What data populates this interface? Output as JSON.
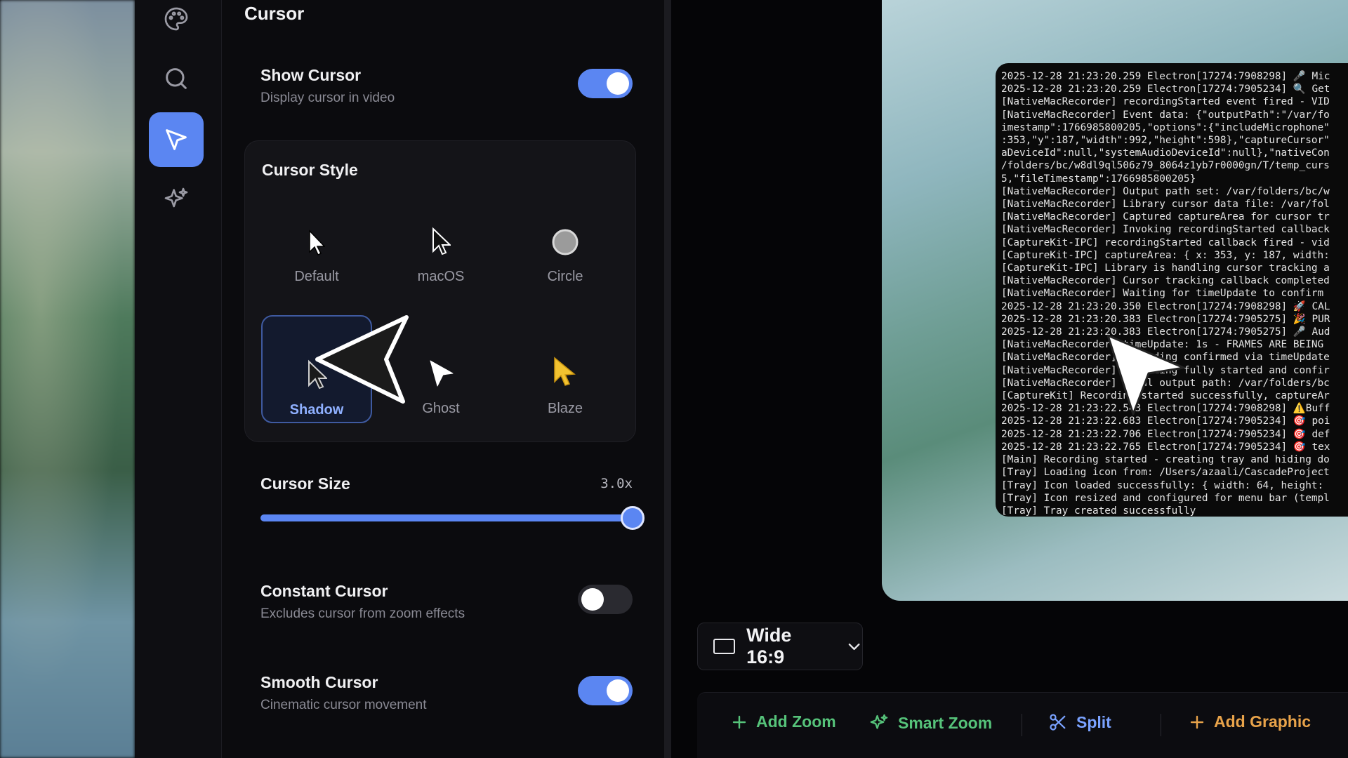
{
  "panel": {
    "title": "Cursor"
  },
  "show_cursor": {
    "title": "Show Cursor",
    "subtitle": "Display cursor in video",
    "enabled": true
  },
  "cursor_style": {
    "title": "Cursor Style",
    "options": [
      {
        "label": "Default"
      },
      {
        "label": "macOS"
      },
      {
        "label": "Circle"
      },
      {
        "label": "Shadow",
        "selected": true
      },
      {
        "label": "Ghost"
      },
      {
        "label": "Blaze"
      }
    ]
  },
  "cursor_size": {
    "title": "Cursor Size",
    "value_label": "3.0x",
    "fraction": 1.0
  },
  "constant_cursor": {
    "title": "Constant Cursor",
    "subtitle": "Excludes cursor from zoom effects",
    "enabled": false
  },
  "smooth_cursor": {
    "title": "Smooth Cursor",
    "subtitle": "Cinematic cursor movement",
    "enabled": true
  },
  "aspect": {
    "label": "Wide 16:9"
  },
  "toolbar": {
    "add_zoom": "Add Zoom",
    "smart_zoom": "Smart Zoom",
    "split": "Split",
    "add_graphic": "Add Graphic"
  },
  "rail": {
    "icons": [
      "palette-icon",
      "search-icon",
      "cursor-icon",
      "sparkles-icon"
    ]
  },
  "colors": {
    "accent": "#5b86f2",
    "green": "#56c37a",
    "blue": "#7aa2ff",
    "orange": "#e8a34a",
    "blaze": "#f2c230"
  },
  "terminal_lines": [
    "2025-12-28 21:23:20.259 Electron[17274:7908298] 🎤 Mic",
    "2025-12-28 21:23:20.259 Electron[17274:7905234] 🔍 Get",
    "[NativeMacRecorder] recordingStarted event fired - VID",
    "[NativeMacRecorder] Event data: {\"outputPath\":\"/var/fo",
    "imestamp\":1766985800205,\"options\":{\"includeMicrophone\"",
    ":353,\"y\":187,\"width\":992,\"height\":598},\"captureCursor\"",
    "aDeviceId\":null,\"systemAudioDeviceId\":null},\"nativeCon",
    "/folders/bc/w8dl9ql506z79_8064z1yb7r0000gn/T/temp_curs",
    "5,\"fileTimestamp\":1766985800205}",
    "[NativeMacRecorder] Output path set: /var/folders/bc/w",
    "[NativeMacRecorder] Library cursor data file: /var/fol",
    "[NativeMacRecorder] Captured captureArea for cursor tr",
    "[NativeMacRecorder] Invoking recordingStarted callback",
    "[CaptureKit-IPC] recordingStarted callback fired - vid",
    "[CaptureKit-IPC] captureArea: { x: 353, y: 187, width:",
    "[CaptureKit-IPC] Library is handling cursor tracking a",
    "[NativeMacRecorder] Cursor tracking callback completed",
    "[NativeMacRecorder] Waiting for timeUpdate to confirm",
    "2025-12-28 21:23:20.350 Electron[17274:7908298] 🚀 CAL",
    "2025-12-28 21:23:20.383 Electron[17274:7905275] 🎉 PUR",
    "2025-12-28 21:23:20.383 Electron[17274:7905275] 🎤 Aud",
    "[NativeMacRecorder] timeUpdate: 1s - FRAMES ARE BEING",
    "[NativeMacRecorder] Recording confirmed via timeUpdate",
    "[NativeMacRecorder] Recording fully started and confir",
    "[NativeMacRecorder] Final output path: /var/folders/bc",
    "[CaptureKit] Recording started successfully, captureAr",
    "2025-12-28 21:23:22.543 Electron[17274:7908298] ⚠️Buff",
    "2025-12-28 21:23:22.683 Electron[17274:7905234] 🎯 poi",
    "2025-12-28 21:23:22.706 Electron[17274:7905234] 🎯 def",
    "2025-12-28 21:23:22.765 Electron[17274:7905234] 🎯 tex",
    "[Main] Recording started - creating tray and hiding do",
    "[Tray] Loading icon from: /Users/azaali/CascadeProject",
    "[Tray] Icon loaded successfully: { width: 64, height:",
    "[Tray] Icon resized and configured for menu bar (templ",
    "[Tray] Tray created successfully"
  ]
}
